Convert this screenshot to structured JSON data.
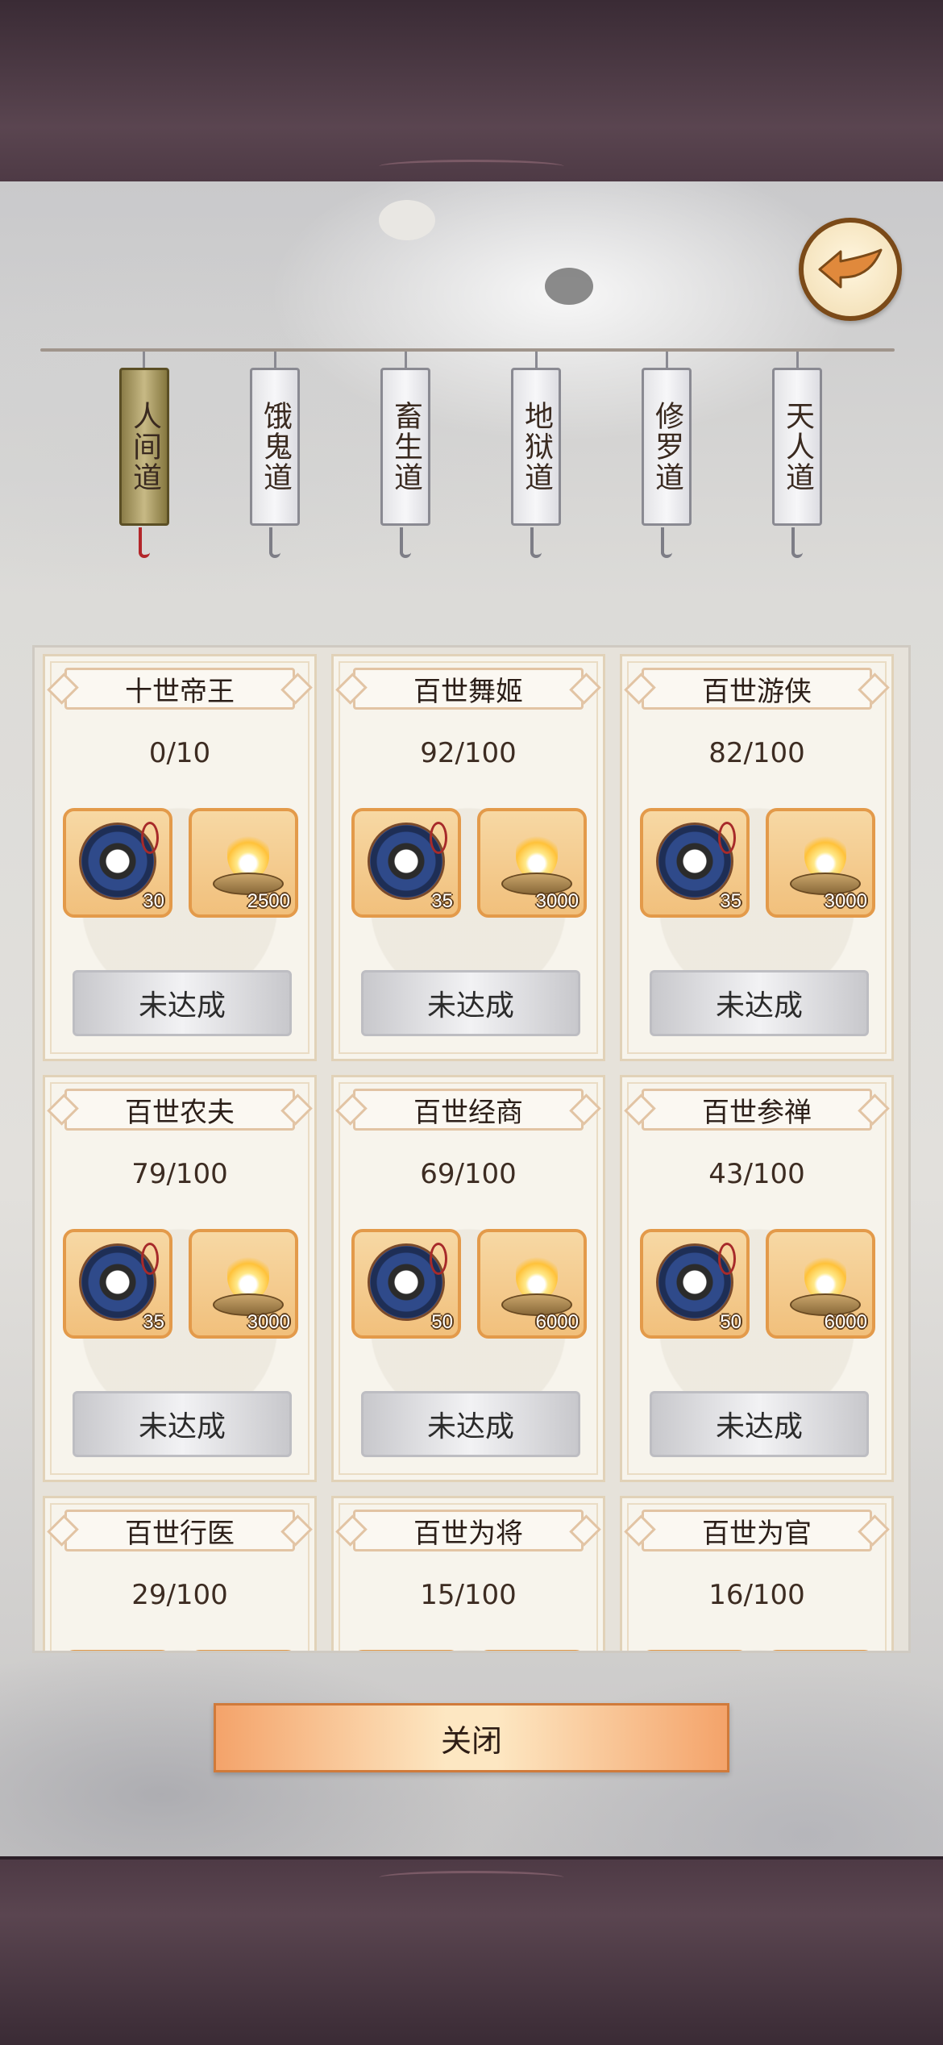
{
  "tabs": [
    {
      "label": "人间道",
      "active": true
    },
    {
      "label": "饿鬼道",
      "active": false
    },
    {
      "label": "畜生道",
      "active": false
    },
    {
      "label": "地狱道",
      "active": false
    },
    {
      "label": "修罗道",
      "active": false
    },
    {
      "label": "天人道",
      "active": false
    }
  ],
  "cards": [
    {
      "title": "十世帝王",
      "progress": "0/10",
      "rewards": [
        {
          "icon": "bagua-compass-icon",
          "qty": "30"
        },
        {
          "icon": "incense-flame-icon",
          "qty": "2500"
        }
      ],
      "button": "未达成"
    },
    {
      "title": "百世舞姬",
      "progress": "92/100",
      "rewards": [
        {
          "icon": "bagua-compass-icon",
          "qty": "35"
        },
        {
          "icon": "incense-flame-icon",
          "qty": "3000"
        }
      ],
      "button": "未达成"
    },
    {
      "title": "百世游侠",
      "progress": "82/100",
      "rewards": [
        {
          "icon": "bagua-compass-icon",
          "qty": "35"
        },
        {
          "icon": "incense-flame-icon",
          "qty": "3000"
        }
      ],
      "button": "未达成"
    },
    {
      "title": "百世农夫",
      "progress": "79/100",
      "rewards": [
        {
          "icon": "bagua-compass-icon",
          "qty": "35"
        },
        {
          "icon": "incense-flame-icon",
          "qty": "3000"
        }
      ],
      "button": "未达成"
    },
    {
      "title": "百世经商",
      "progress": "69/100",
      "rewards": [
        {
          "icon": "bagua-compass-icon",
          "qty": "50"
        },
        {
          "icon": "incense-flame-icon",
          "qty": "6000"
        }
      ],
      "button": "未达成"
    },
    {
      "title": "百世参禅",
      "progress": "43/100",
      "rewards": [
        {
          "icon": "bagua-compass-icon",
          "qty": "50"
        },
        {
          "icon": "incense-flame-icon",
          "qty": "6000"
        }
      ],
      "button": "未达成"
    },
    {
      "title": "百世行医",
      "progress": "29/100"
    },
    {
      "title": "百世为将",
      "progress": "15/100"
    },
    {
      "title": "百世为官",
      "progress": "16/100"
    }
  ],
  "close_button": "关闭",
  "colors": {
    "accent": "#e39a4a",
    "active_tab": "#b8a86e",
    "frame": "#4a3a44"
  }
}
